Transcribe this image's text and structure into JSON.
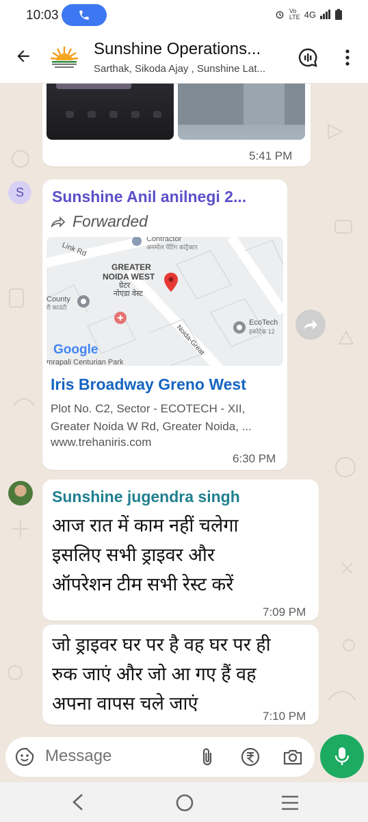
{
  "status_bar": {
    "time": "10:03",
    "network": "4G",
    "icons": [
      "phone-call-icon",
      "alarm-icon",
      "volte-icon",
      "signal-icon",
      "battery-icon"
    ]
  },
  "header": {
    "title": "Sunshine Operations...",
    "subtitle": "Sarthak, Sikoda Ajay , Sunshine Lat..."
  },
  "messages": [
    {
      "type": "media",
      "time": "5:41 PM"
    },
    {
      "type": "location_link",
      "avatar_letter": "S",
      "sender": "Sunshine Anil anilnegi 2...",
      "forwarded_label": "Forwarded",
      "map": {
        "labels": [
          "Link Rd",
          "Contractor",
          "अनमोल पेंटिंग कांट्रैक्टर",
          "GREATER",
          "NOIDA WEST",
          "ग्रेटर",
          "नोएडा वेस्ट",
          "County",
          "री काउंटी",
          "EcoTech",
          "इकोटेक 12",
          "Noida-Great",
          "mrapali Centurian Park"
        ],
        "brand": "Google"
      },
      "link_title": "Iris Broadway Greno West",
      "link_desc_1": "Plot No. C2, Sector - ECOTECH - XII,",
      "link_desc_2": "Greater Noida W Rd, Greater Noida, ...",
      "link_domain": "www.trehaniris.com",
      "time": "6:30 PM"
    },
    {
      "type": "text",
      "sender": "Sunshine jugendra singh",
      "lines": [
        "आज रात में काम नहीं चलेगा",
        "इसलिए सभी ड्राइवर और",
        "ऑपरेशन टीम सभी रेस्ट करें"
      ],
      "time": "7:09 PM"
    },
    {
      "type": "text",
      "lines": [
        "जो ड्राइवर घर पर है वह घर पर ही",
        "रुक जाएं और जो आ गए हैं वह",
        "अपना वापस चले  जाएं"
      ],
      "time": "7:10 PM"
    }
  ],
  "composer": {
    "placeholder": "Message"
  },
  "colors": {
    "accent_green": "#1daa61",
    "sender1": "#5b4fc8",
    "sender2": "#1f7f8f",
    "link": "#1565c0",
    "chat_bg": "#efe7de"
  }
}
